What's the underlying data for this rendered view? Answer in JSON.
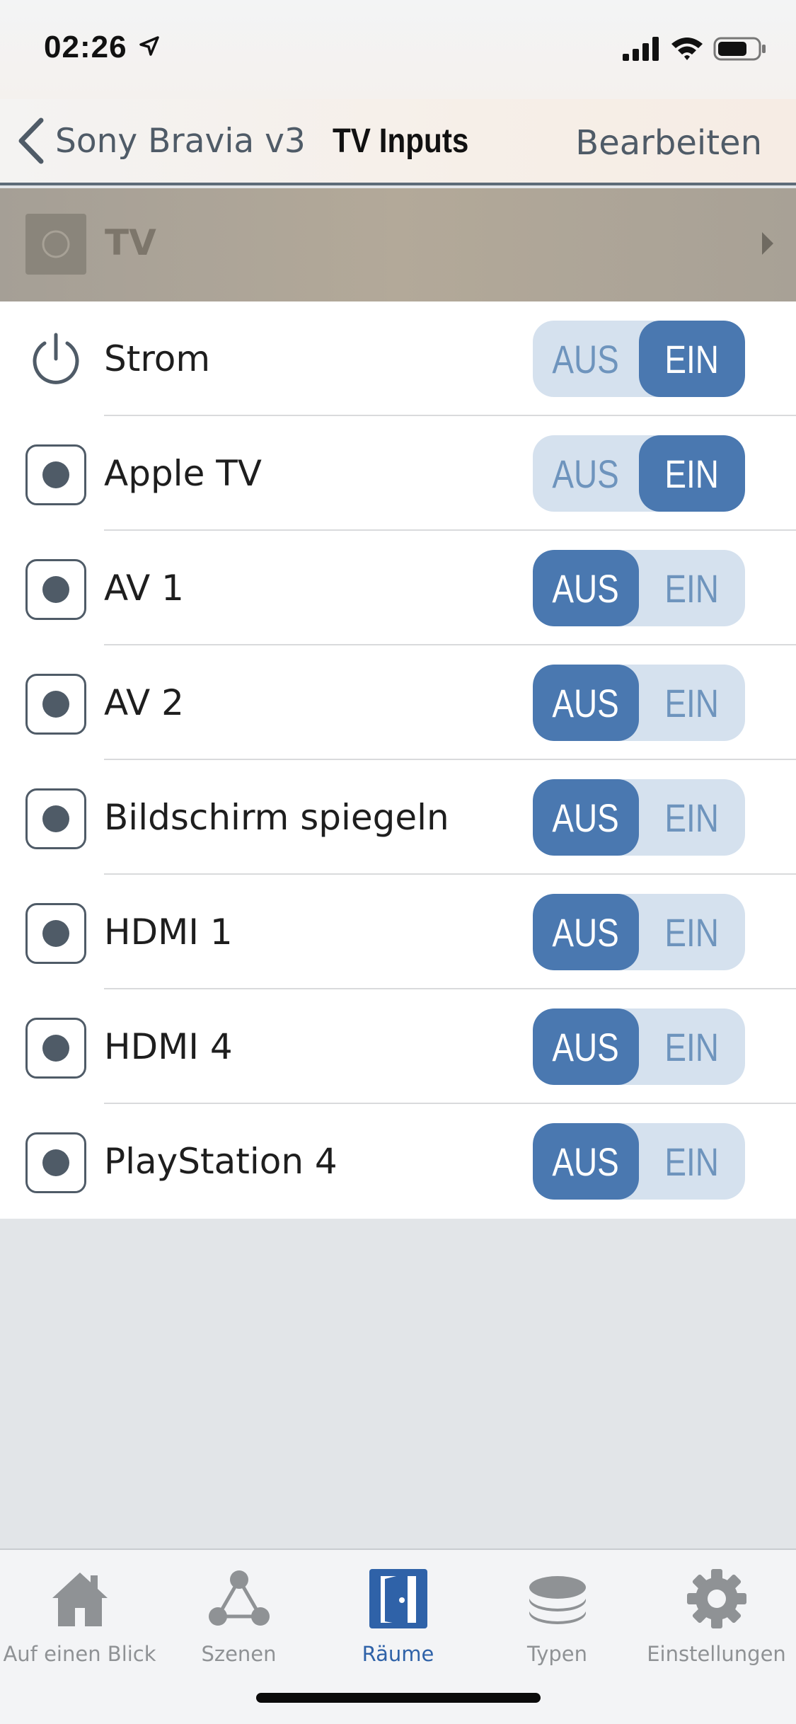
{
  "status_bar": {
    "time": "02:26",
    "icons": [
      "location-arrow-icon",
      "signal-icon",
      "wifi-icon",
      "battery-icon"
    ]
  },
  "nav": {
    "back_label": "Sony Bravia v3",
    "title": "TV Inputs",
    "edit_label": "Bearbeiten"
  },
  "device": {
    "label": "TV"
  },
  "toggle_labels": {
    "off": "AUS",
    "on": "EIN"
  },
  "items": [
    {
      "label": "Strom",
      "icon": "power-icon",
      "state": "EIN"
    },
    {
      "label": "Apple TV",
      "icon": "radio-input-icon",
      "state": "EIN"
    },
    {
      "label": "AV 1",
      "icon": "radio-input-icon",
      "state": "AUS"
    },
    {
      "label": "AV 2",
      "icon": "radio-input-icon",
      "state": "AUS"
    },
    {
      "label": "Bildschirm spiegeln",
      "icon": "radio-input-icon",
      "state": "AUS"
    },
    {
      "label": "HDMI 1",
      "icon": "radio-input-icon",
      "state": "AUS"
    },
    {
      "label": "HDMI 4",
      "icon": "radio-input-icon",
      "state": "AUS"
    },
    {
      "label": "PlayStation 4",
      "icon": "radio-input-icon",
      "state": "AUS"
    }
  ],
  "tabs": [
    {
      "label": "Auf einen Blick",
      "icon": "house-icon",
      "active": false
    },
    {
      "label": "Szenen",
      "icon": "scenes-icon",
      "active": false
    },
    {
      "label": "Räume",
      "icon": "door-icon",
      "active": true
    },
    {
      "label": "Typen",
      "icon": "layers-icon",
      "active": false
    },
    {
      "label": "Einstellungen",
      "icon": "gear-icon",
      "active": false
    }
  ],
  "colors": {
    "accent": "#4a78b0",
    "toggle_inactive": "#d5e1ee",
    "tab_active": "#2f62a8",
    "tab_inactive": "#8f9295"
  }
}
